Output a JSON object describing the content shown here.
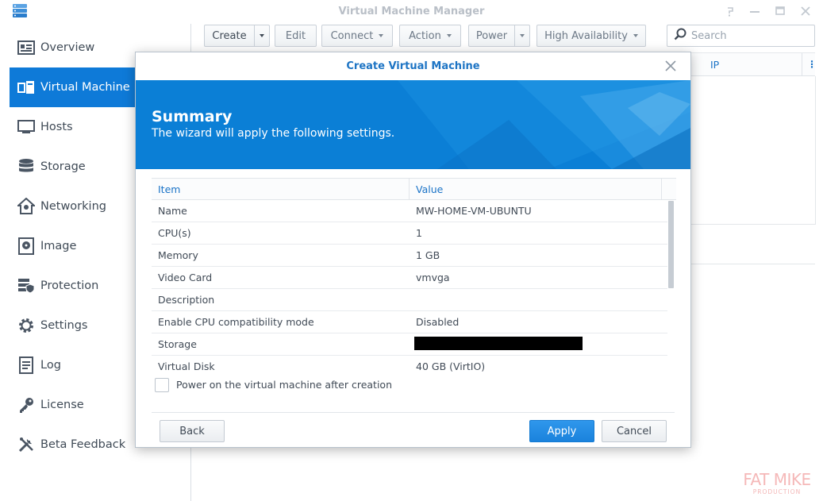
{
  "window": {
    "title": "Virtual Machine Manager"
  },
  "sidebar": {
    "items": [
      {
        "label": "Overview",
        "icon": "overview-icon",
        "active": false
      },
      {
        "label": "Virtual Machine",
        "icon": "virtual-machine-icon",
        "active": true
      },
      {
        "label": "Hosts",
        "icon": "hosts-icon",
        "active": false
      },
      {
        "label": "Storage",
        "icon": "storage-icon",
        "active": false
      },
      {
        "label": "Networking",
        "icon": "networking-icon",
        "active": false
      },
      {
        "label": "Image",
        "icon": "image-icon",
        "active": false
      },
      {
        "label": "Protection",
        "icon": "protection-icon",
        "active": false
      },
      {
        "label": "Settings",
        "icon": "settings-icon",
        "active": false
      },
      {
        "label": "Log",
        "icon": "log-icon",
        "active": false
      },
      {
        "label": "License",
        "icon": "license-icon",
        "active": false
      },
      {
        "label": "Beta Feedback",
        "icon": "beta-feedback-icon",
        "active": false
      }
    ]
  },
  "toolbar": {
    "create": "Create",
    "edit": "Edit",
    "connect": "Connect",
    "action": "Action",
    "power": "Power",
    "high_availability": "High Availability",
    "search_placeholder": "Search"
  },
  "background_grid": {
    "columns": [
      "IP"
    ]
  },
  "dialog": {
    "title": "Create Virtual Machine",
    "heading": "Summary",
    "subheading": "The wizard will apply the following settings.",
    "columns": {
      "item": "Item",
      "value": "Value"
    },
    "rows": [
      {
        "item": "Name",
        "value": "MW-HOME-VM-UBUNTU"
      },
      {
        "item": "CPU(s)",
        "value": "1"
      },
      {
        "item": "Memory",
        "value": "1 GB"
      },
      {
        "item": "Video Card",
        "value": "vmvga"
      },
      {
        "item": "Description",
        "value": ""
      },
      {
        "item": "Enable CPU compatibility mode",
        "value": "Disabled"
      },
      {
        "item": "Storage",
        "value": "",
        "redacted": true
      },
      {
        "item": "Virtual Disk",
        "value": "40 GB (VirtIO)"
      }
    ],
    "power_on_label": "Power on the virtual machine after creation",
    "power_on_checked": false,
    "buttons": {
      "back": "Back",
      "apply": "Apply",
      "cancel": "Cancel"
    }
  },
  "watermark": {
    "line1": "FAT MIKE",
    "line2": "PRODUCTION"
  },
  "colors": {
    "accent": "#0e7ad8",
    "banner": "#0b7fd6",
    "link": "#1a73c7"
  }
}
